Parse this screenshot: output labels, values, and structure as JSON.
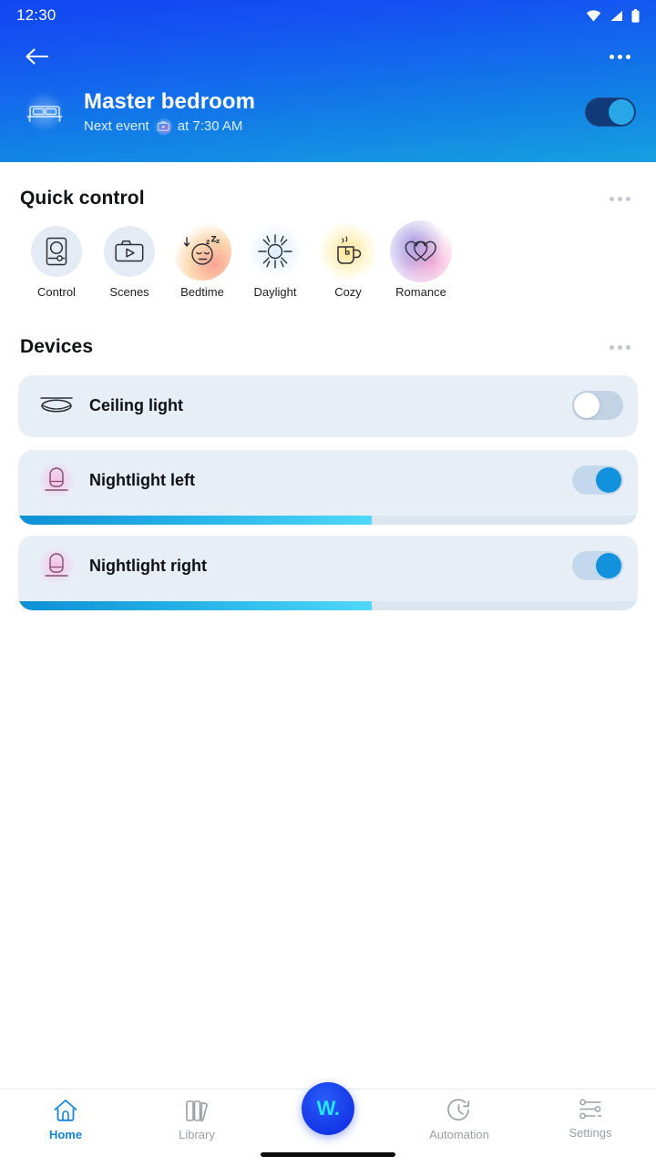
{
  "status_bar": {
    "time": "12:30",
    "icons": [
      "wifi-icon",
      "signal-icon",
      "battery-icon"
    ]
  },
  "header": {
    "back_icon": "back-arrow-icon",
    "overflow_icon": "more-options-icon",
    "room_icon": "bed-icon",
    "title": "Master bedroom",
    "subtitle_prefix": "Next event",
    "subtitle_icon": "scene-camera-icon",
    "subtitle_suffix": "at 7:30 AM",
    "toggle_on": true,
    "gradient_start": "#1146f0",
    "gradient_end": "#15a0e0"
  },
  "quick_control": {
    "title": "Quick control",
    "overflow_icon": "more-options-icon",
    "items": [
      {
        "label": "Control",
        "icon": "control-panel-icon",
        "style": "plain"
      },
      {
        "label": "Scenes",
        "icon": "scenes-camera-icon",
        "style": "plain"
      },
      {
        "label": "Bedtime",
        "icon": "sleeping-face-icon",
        "style": "bedtime"
      },
      {
        "label": "Daylight",
        "icon": "sun-icon",
        "style": "daylight"
      },
      {
        "label": "Cozy",
        "icon": "hot-mug-icon",
        "style": "cozy"
      },
      {
        "label": "Romance",
        "icon": "two-hearts-icon",
        "style": "romance"
      }
    ]
  },
  "devices": {
    "title": "Devices",
    "overflow_icon": "more-options-icon",
    "items": [
      {
        "name": "Ceiling light",
        "icon": "ceiling-light-icon",
        "toggle_on": false,
        "has_slider": false,
        "brightness": 0
      },
      {
        "name": "Nightlight left",
        "icon": "nightlight-lamp-icon",
        "toggle_on": true,
        "has_slider": true,
        "brightness": 57
      },
      {
        "name": "Nightlight right",
        "icon": "nightlight-lamp-icon",
        "toggle_on": true,
        "has_slider": true,
        "brightness": 57
      }
    ]
  },
  "bottom_nav": {
    "items": [
      {
        "label": "Home",
        "icon": "home-icon",
        "active": true
      },
      {
        "label": "Library",
        "icon": "library-books-icon",
        "active": false
      },
      {
        "label": "Automation",
        "icon": "automation-clock-icon",
        "active": false
      },
      {
        "label": "Settings",
        "icon": "settings-sliders-icon",
        "active": false
      }
    ],
    "fab": {
      "label": "W.",
      "icon": "wiz-logo-icon",
      "color": "#1436e8",
      "text_color": "#22e8f5"
    }
  }
}
